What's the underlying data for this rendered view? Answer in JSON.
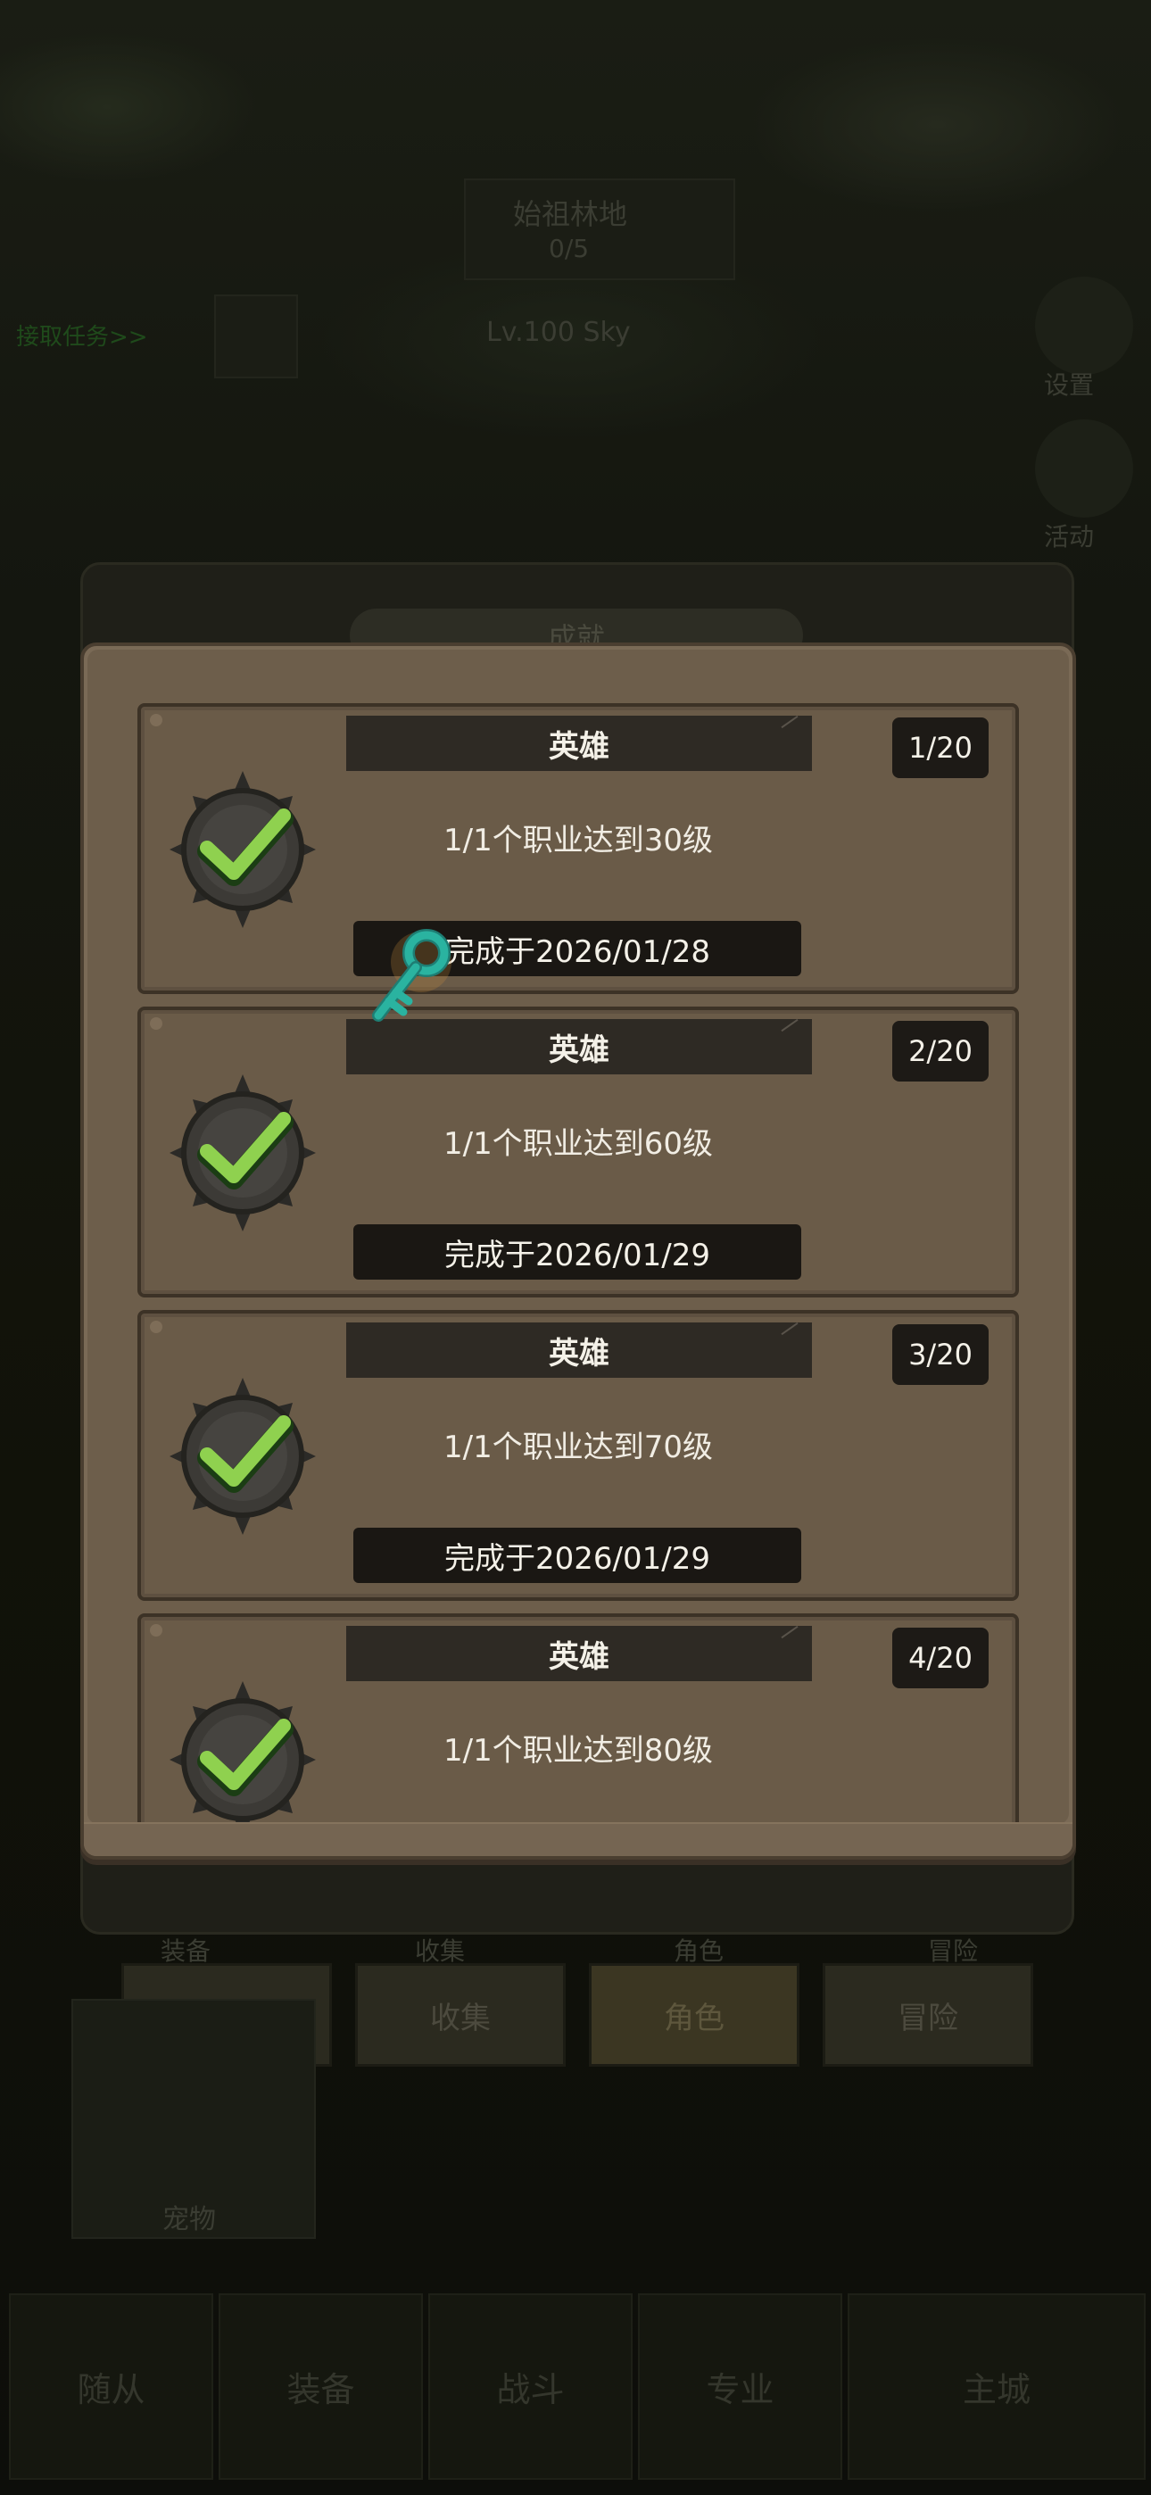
{
  "background": {
    "zone_title": "始祖林地",
    "zone_progress": "0/5",
    "quest_link": "接取任务>>",
    "player_line": "Lv.100 Sky",
    "settings_label": "设置",
    "events_label": "活动",
    "tabs": [
      {
        "label": "装备"
      },
      {
        "label": "收集"
      },
      {
        "label": "角色"
      },
      {
        "label": "冒险"
      }
    ],
    "tab_headers": [
      "装备",
      "收集",
      "角色",
      "冒险"
    ],
    "pet_label": "宠物",
    "bottom_nav": [
      {
        "label": "随从"
      },
      {
        "label": "装备"
      },
      {
        "label": "战斗"
      },
      {
        "label": "专业"
      },
      {
        "label": "主城"
      }
    ]
  },
  "dialog": {
    "title": "成就"
  },
  "achievements": [
    {
      "category": "英雄",
      "count": "1/20",
      "description": "1/1个职业达到30级",
      "completed": "完成于2026/01/28"
    },
    {
      "category": "英雄",
      "count": "2/20",
      "description": "1/1个职业达到60级",
      "completed": "完成于2026/01/29"
    },
    {
      "category": "英雄",
      "count": "3/20",
      "description": "1/1个职业达到70级",
      "completed": "完成于2026/01/29"
    },
    {
      "category": "英雄",
      "count": "4/20",
      "description": "1/1个职业达到80级",
      "completed": ""
    }
  ],
  "colors": {
    "panel": "#7a6a56",
    "card": "#6a5b48",
    "header": "#2e2a24",
    "check": "#8fd14f",
    "key": "#2ab3a0"
  },
  "icons": {
    "badge": "completed-check-badge-icon",
    "cursor": "key-icon"
  }
}
